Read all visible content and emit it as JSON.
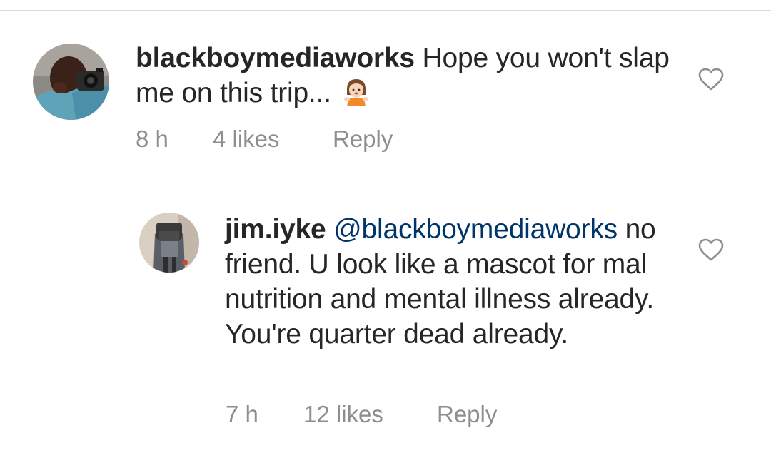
{
  "comments": [
    {
      "username": "blackboymediaworks",
      "text": "Hope you won't slap me on this trip...",
      "emoji": "person-gesturing-emoji",
      "time": "8 h",
      "likes": "4 likes",
      "reply_label": "Reply"
    },
    {
      "username": "jim.iyke",
      "mention": "@blackboymediaworks",
      "text": "no friend. U look like a mascot for mal nutrition and mental illness already. You're quarter dead already.",
      "time": "7 h",
      "likes": "12 likes",
      "reply_label": "Reply"
    }
  ],
  "icons": {
    "like": "heart-outline-icon"
  },
  "colors": {
    "text": "#262626",
    "meta": "#8e8e8e",
    "mention": "#003569",
    "divider": "#dbdbdb"
  }
}
